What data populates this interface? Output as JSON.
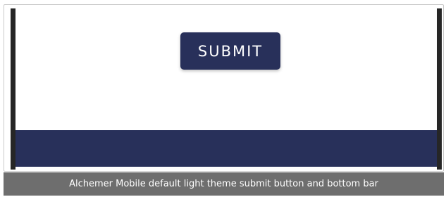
{
  "screen": {
    "submit_label": "SUBMIT"
  },
  "caption": {
    "text": "Alchemer Mobile default light theme submit button and bottom bar"
  },
  "colors": {
    "primary": "#28305a",
    "device_bezel": "#262626",
    "caption_background": "#6e6e6e"
  }
}
